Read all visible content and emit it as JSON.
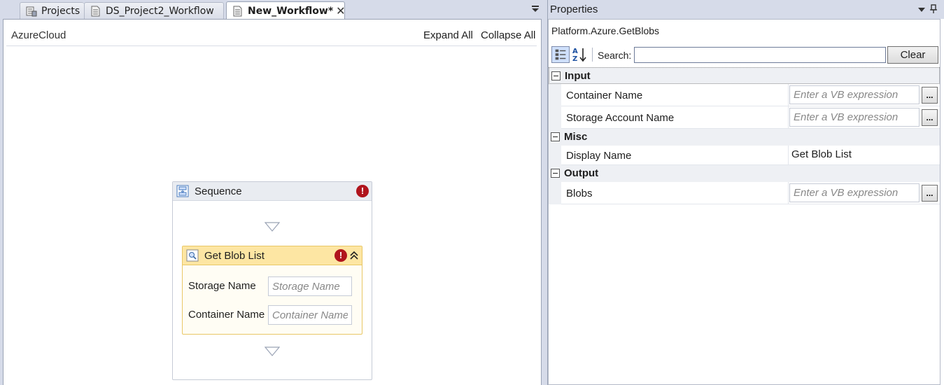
{
  "tabs": [
    {
      "label": "Projects",
      "icon": "project-list-icon"
    },
    {
      "label": "DS_Project2_Workflow",
      "icon": "document-icon"
    },
    {
      "label": "New_Workflow*",
      "icon": "document-icon",
      "active": true,
      "close": "✕"
    }
  ],
  "designer": {
    "breadcrumb": "AzureCloud",
    "expand_all": "Expand All",
    "collapse_all": "Collapse All",
    "sequence": {
      "title": "Sequence",
      "error_mark": "!",
      "activity": {
        "title": "Get Blob List",
        "error_mark": "!",
        "fields": [
          {
            "label": "Storage Name",
            "placeholder": "Storage Name"
          },
          {
            "label": "Container Name",
            "placeholder": "Container Name"
          }
        ]
      }
    }
  },
  "properties": {
    "title": "Properties",
    "activity_type": "Platform.Azure.GetBlobs",
    "search_label": "Search:",
    "search_value": "",
    "clear_label": "Clear",
    "ellipsis": "...",
    "categories": [
      {
        "name": "Input",
        "props": [
          {
            "name": "Container Name",
            "placeholder": "Enter a VB expression"
          },
          {
            "name": "Storage Account Name",
            "placeholder": "Enter a VB expression"
          }
        ]
      },
      {
        "name": "Misc",
        "props": [
          {
            "name": "Display Name",
            "value": "Get Blob List"
          }
        ]
      },
      {
        "name": "Output",
        "props": [
          {
            "name": "Blobs",
            "placeholder": "Enter a VB expression"
          }
        ]
      }
    ]
  },
  "colors": {
    "chrome": "#d6dbe9",
    "activity_header": "#fde6a3",
    "activity_border": "#e9c766",
    "error_badge": "#b0141c"
  }
}
